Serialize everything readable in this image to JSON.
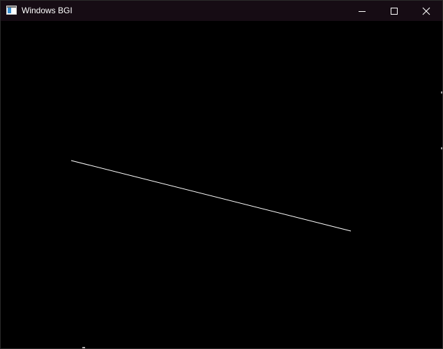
{
  "window": {
    "title": "Windows BGI"
  },
  "titlebar": {
    "app_icon": "window-app-icon",
    "background": "#160c14",
    "buttons": [
      {
        "name": "minimize",
        "icon": "minimize-icon"
      },
      {
        "name": "maximize",
        "icon": "maximize-icon"
      },
      {
        "name": "close",
        "icon": "close-icon"
      }
    ]
  },
  "canvas": {
    "background": "#000000",
    "line_color": "#ffffff"
  }
}
